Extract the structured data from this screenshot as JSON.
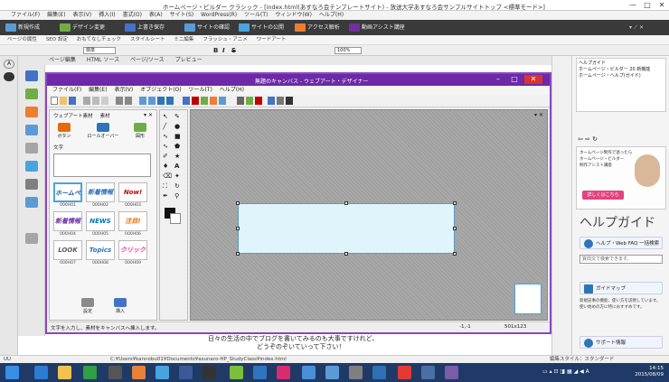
{
  "app": {
    "title": "ホームページ・ビルダー クラシック - [index.html(あすなろ会テンプレートサイト) - 放送大学あすなろ会サンプルサイトトップ <標準モード>]",
    "window_controls": [
      "—",
      "□",
      "✕"
    ]
  },
  "menu": [
    "ファイル(F)",
    "編集(E)",
    "表示(V)",
    "挿入(I)",
    "書式(O)",
    "表(A)",
    "サイト(S)",
    "WordPress(R)",
    "ツール(T)",
    "ウィンドウ(W)",
    "ヘルプ(H)"
  ],
  "ribbon": [
    {
      "label": "新規作成",
      "color": "#5b9bd5",
      "icon": "new-icon"
    },
    {
      "label": "デザイン変更",
      "color": "#70ad47",
      "icon": "design-icon"
    },
    {
      "label": "上書き保存",
      "color": "#4472c4",
      "icon": "save-icon"
    },
    {
      "label": "サイトの確認",
      "color": "#5b9bd5",
      "icon": "site-check-icon"
    },
    {
      "label": "サイトの公開",
      "color": "#4aa3df",
      "icon": "publish-icon"
    },
    {
      "label": "アクセス解析",
      "color": "#ed7d31",
      "icon": "analytics-icon"
    },
    {
      "label": "動画アシスト講座",
      "color": "#7030a0",
      "icon": "video-icon"
    }
  ],
  "toolbar2": [
    "ページの属性",
    "SEO 設定",
    "おもてなしチェック",
    "スタイルシート",
    "ミニ編集",
    "フラッシュ・アニメ",
    "ワードアート"
  ],
  "toolbar3": {
    "style": "標準",
    "zoom": "100%"
  },
  "tabs": [
    "ページ編集",
    "HTML ソース",
    "ページ/ソース",
    "プレビュー"
  ],
  "dialog": {
    "title": "無題のキャンバス - ウェブアート・デザイナー",
    "menu": [
      "ファイル(F)",
      "編集(E)",
      "表示(V)",
      "オブジェクト(O)",
      "ツール(T)",
      "ヘルプ(H)"
    ],
    "material_tabs": [
      "ウェブアート素材",
      "素材"
    ],
    "button_types": [
      {
        "label": "ボタン",
        "color": "#e36c09"
      },
      {
        "label": "ロールオーバー",
        "color": "#2e75b6"
      },
      {
        "label": "図形",
        "color": "#70ad47"
      }
    ],
    "text_label": "文字",
    "thumbs": [
      {
        "text": "ホームページ",
        "label": "000H01",
        "color": "#1f4e9a"
      },
      {
        "text": "新着情報",
        "label": "000H02",
        "color": "#2f6db5"
      },
      {
        "text": "Now!",
        "label": "000H03",
        "color": "#c00000"
      },
      {
        "text": "新着情報",
        "label": "000H04",
        "color": "#7030a0"
      },
      {
        "text": "NEWS",
        "label": "000H05",
        "color": "#0070c0"
      },
      {
        "text": "注目!",
        "label": "000H06",
        "color": "#e46c0a"
      },
      {
        "text": "LOOK",
        "label": "000H07",
        "color": "#595959"
      },
      {
        "text": "Topics",
        "label": "000H08",
        "color": "#2e75b6"
      },
      {
        "text": "クリック",
        "label": "000H09",
        "color": "#ff3399"
      }
    ],
    "bottom_buttons": [
      "設定",
      "挿入"
    ],
    "status_left": "文字を入力し、素材をキャンバスへ挿入します。",
    "status_mid": "-1,-1",
    "status_right": "501x123"
  },
  "right_panel": {
    "help_items": [
      "ヘルプガイド",
      "ホームページ・ビルダー 20 新機能",
      "ホームページ・ヘルプ(ガイド)"
    ],
    "ad_lines": [
      "ホームページ制作で迷ったら",
      "ホームページ・ビルダー",
      "制作アシスト講座"
    ],
    "ad_button": "詳しくはこちら",
    "help_title": "ヘルプガイド",
    "items": [
      {
        "label": "ヘルプ・Web FAQ 一括検索",
        "color": "#2e75b6"
      },
      {
        "label": "ガイドマップ",
        "color": "#2e75b6"
      },
      {
        "label": "サポート情報",
        "color": "#2e75b6"
      }
    ],
    "search_placeholder": "質問文で検索できます。",
    "guide_desc": "新規記事の機能、使い方を説明しています。使い始めの方に特におすすめです。"
  },
  "page_text": [
    "日々の生活の中でブログを書いてみるのも大事ですけれど、",
    "どうぞのぞいていって下さい！"
  ],
  "statusbar": {
    "left": "UU",
    "path": "C:¥Users¥kannobu01¥Documents¥asunaro-HP_StudyClass¥index.html",
    "right": "編集スタイル：スタンダード"
  },
  "clock": {
    "time": "14:15",
    "date": "2015/08/09"
  }
}
